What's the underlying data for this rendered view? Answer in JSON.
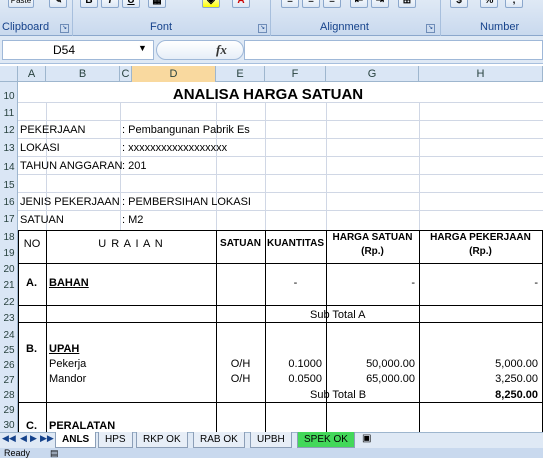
{
  "ribbon": {
    "clipboard_label": "Clipboard",
    "paste_label": "Paste",
    "font_label": "Font",
    "alignment_label": "Alignment",
    "number_label": "Number",
    "bold_glyph": "B",
    "italic_glyph": "I",
    "underline_glyph": "U",
    "percent_glyph": "%"
  },
  "formula_bar": {
    "name_box": "D54",
    "fx": "fx",
    "content": ""
  },
  "columns": [
    "A",
    "B",
    "C",
    "D",
    "E",
    "F",
    "G",
    "H"
  ],
  "selected_column": "D",
  "row_numbers": [
    "10",
    "11",
    "12",
    "13",
    "14",
    "15",
    "16",
    "17",
    "18",
    "19",
    "20",
    "21",
    "22",
    "23",
    "24",
    "25",
    "26",
    "27",
    "28",
    "29",
    "30"
  ],
  "sheet": {
    "title": "ANALISA HARGA SATUAN",
    "pekerjaan_label": "PEKERJAAN",
    "pekerjaan_value": ": Pembangunan Pabrik Es",
    "lokasi_label": "LOKASI",
    "lokasi_value": ": xxxxxxxxxxxxxxxxxx",
    "tahun_label": "TAHUN ANGGARAN",
    "tahun_value": ": 201",
    "jenis_label": "JENIS PEKERJAAN",
    "jenis_value": ":  PEMBERSIHAN LOKASI",
    "satuan_label": "SATUAN",
    "satuan_value": ":  M2",
    "headers": {
      "no": "NO",
      "uraian": "U R A I A N",
      "satuan": "SATUAN",
      "kuantitas": "KUANTITAS",
      "harga_satuan": "HARGA SATUAN",
      "harga_satuan_unit": "(Rp.)",
      "harga_pekerjaan": "HARGA PEKERJAAN",
      "harga_pekerjaan_unit": "(Rp.)"
    },
    "section_a": {
      "no": "A.",
      "name": "BAHAN",
      "kuantitas": "-",
      "harga_satuan": "-",
      "harga_pekerjaan": "-"
    },
    "subtotal_a": "Sub Total  A",
    "section_b": {
      "no": "B.",
      "name": "UPAH"
    },
    "upah_rows": [
      {
        "name": "Pekerja",
        "unit": "O/H",
        "qty": "0.1000",
        "price": "50,000.00",
        "total": "5,000.00"
      },
      {
        "name": "Mandor",
        "unit": "O/H",
        "qty": "0.0500",
        "price": "65,000.00",
        "total": "3,250.00"
      }
    ],
    "subtotal_b": "Sub Total  B",
    "subtotal_b_value": "8,250.00",
    "section_c": {
      "no": "C.",
      "name": "PERALATAN"
    }
  },
  "tabs": [
    "ANLS",
    "HPS",
    "RKP OK",
    "RAB OK",
    "UPBH",
    "SPEK OK"
  ],
  "active_tab": "ANLS",
  "status": {
    "ready": "Ready"
  }
}
